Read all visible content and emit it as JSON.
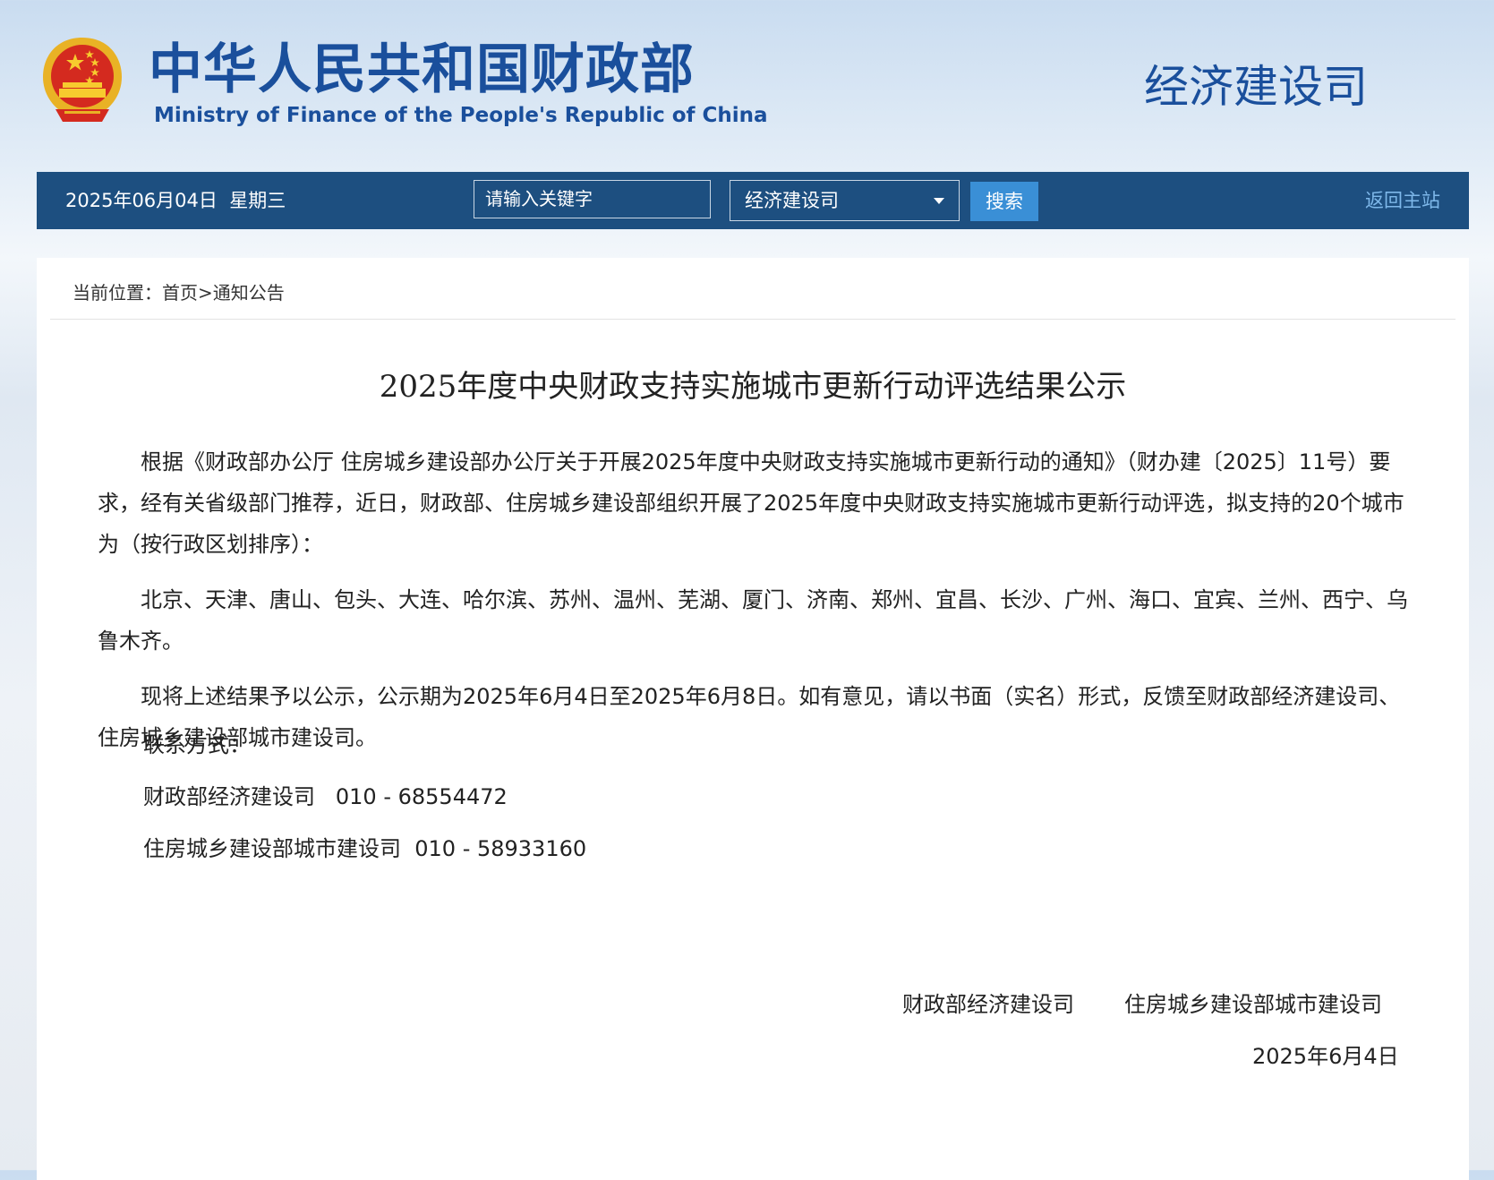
{
  "header": {
    "site_name_cn": "中华人民共和国财政部",
    "site_name_en": "Ministry of Finance of the People's Republic of China",
    "department": "经济建设司"
  },
  "navbar": {
    "date": "2025年06月04日",
    "weekday": "星期三",
    "search_placeholder": "请输入关键字",
    "select_value": "经济建设司",
    "search_button": "搜索",
    "home_link": "返回主站"
  },
  "breadcrumb": {
    "prefix": "当前位置：",
    "home": "首页",
    "separator": ">",
    "current": "通知公告"
  },
  "article": {
    "title": "2025年度中央财政支持实施城市更新行动评选结果公示",
    "paragraphs": [
      "根据《财政部办公厅 住房城乡建设部办公厅关于开展2025年度中央财政支持实施城市更新行动的通知》（财办建〔2025〕11号）要求，经有关省级部门推荐，近日，财政部、住房城乡建设部组织开展了2025年度中央财政支持实施城市更新行动评选，拟支持的20个城市为（按行政区划排序）：",
      "北京、天津、唐山、包头、大连、哈尔滨、苏州、温州、芜湖、厦门、济南、郑州、宜昌、长沙、广州、海口、宜宾、兰州、西宁、乌鲁木齐。",
      "现将上述结果予以公示，公示期为2025年6月4日至2025年6月8日。如有意见，请以书面（实名）形式，反馈至财政部经济建设司、住房城乡建设部城市建设司。"
    ],
    "contact_heading": "联系方式：",
    "contacts": [
      "财政部经济建设司   010 - 68554472",
      "住房城乡建设部城市建设司  010 - 58933160"
    ],
    "signatories": [
      "财政部经济建设司",
      "住房城乡建设部城市建设司"
    ],
    "sign_date": "2025年6月4日"
  },
  "colors": {
    "brand_blue": "#1a4f9c",
    "navbar_bg": "#1d4f80",
    "search_button_bg": "#3a8fd6",
    "home_link": "#7eb8ea"
  }
}
